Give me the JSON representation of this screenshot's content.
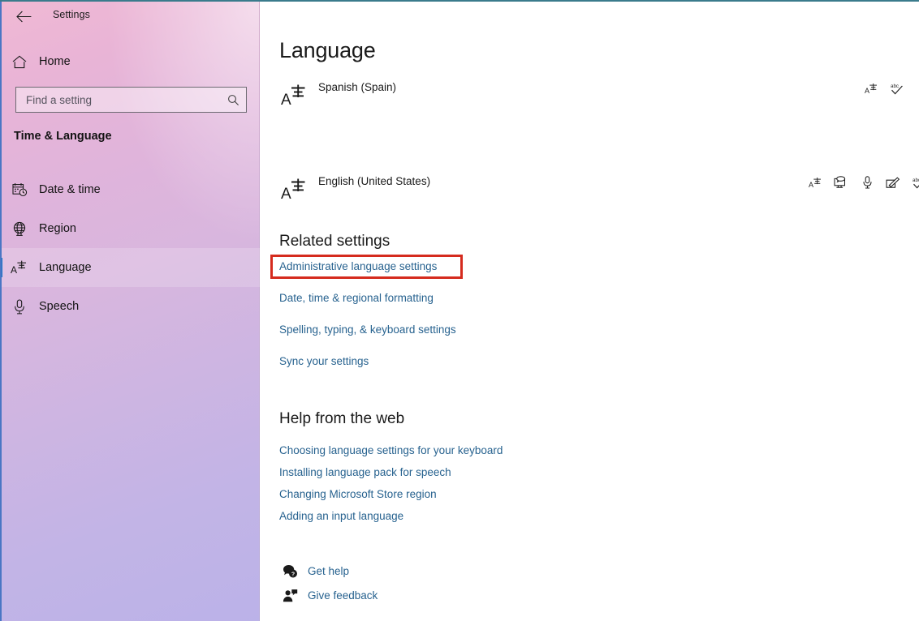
{
  "window": {
    "title": "Settings",
    "back_icon": "back-arrow-icon",
    "controls": {
      "minimize": "minimize-icon",
      "maximize": "maximize-icon",
      "close": "close-icon"
    }
  },
  "sidebar": {
    "home_label": "Home",
    "home_icon": "home-icon",
    "search": {
      "placeholder": "Find a setting",
      "value": "",
      "icon": "search-icon"
    },
    "group_title": "Time & Language",
    "items": [
      {
        "label": "Date & time",
        "icon": "calendar-clock-icon",
        "selected": false
      },
      {
        "label": "Region",
        "icon": "globe-icon",
        "selected": false
      },
      {
        "label": "Language",
        "icon": "language-icon",
        "selected": true
      },
      {
        "label": "Speech",
        "icon": "microphone-icon",
        "selected": false
      }
    ],
    "accent_color": "#1673c8"
  },
  "main": {
    "page_title": "Language",
    "languages": [
      {
        "name": "Spanish (Spain)",
        "icon": "language-icon",
        "features": [
          "language-pack-icon",
          "spellcheck-icon"
        ]
      },
      {
        "name": "English (United States)",
        "icon": "language-icon",
        "features": [
          "language-pack-icon",
          "text-to-speech-icon",
          "speech-recognition-icon",
          "handwriting-icon",
          "spellcheck-icon"
        ]
      }
    ],
    "related_settings": {
      "heading": "Related settings",
      "links": [
        "Administrative language settings",
        "Date, time & regional formatting",
        "Spelling, typing, & keyboard settings",
        "Sync your settings"
      ]
    },
    "help_from_web": {
      "heading": "Help from the web",
      "links": [
        "Choosing language settings for your keyboard",
        "Installing language pack for speech",
        "Changing Microsoft Store region",
        "Adding an input language"
      ]
    },
    "footer": [
      {
        "label": "Get help",
        "icon": "help-bubble-icon"
      },
      {
        "label": "Give feedback",
        "icon": "feedback-person-icon"
      }
    ],
    "highlight": {
      "target": "Administrative language settings",
      "color": "#d52b1e"
    },
    "link_color": "#27628f"
  }
}
